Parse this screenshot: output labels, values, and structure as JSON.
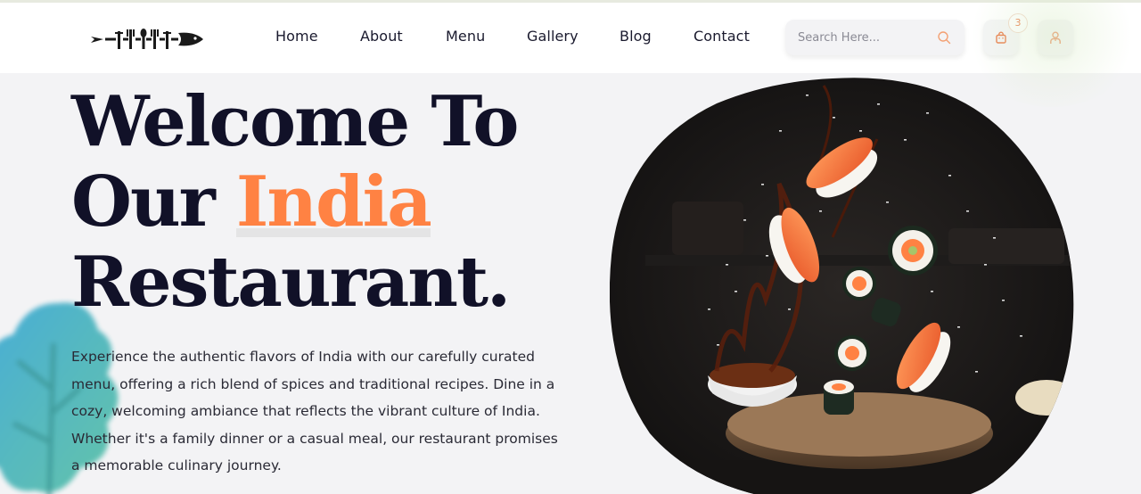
{
  "header": {
    "logo_name": "fork-spoon-fish-logo",
    "nav": [
      {
        "label": "Home"
      },
      {
        "label": "About"
      },
      {
        "label": "Menu"
      },
      {
        "label": "Gallery"
      },
      {
        "label": "Blog"
      },
      {
        "label": "Contact"
      }
    ],
    "search": {
      "placeholder": "Search Here...",
      "value": ""
    },
    "cart": {
      "icon": "shopping-bag-icon",
      "count": "3"
    },
    "user": {
      "icon": "user-icon"
    }
  },
  "hero": {
    "title_line1": "Welcome To",
    "title_line2_prefix": "Our ",
    "title_highlight": "India",
    "title_line3": "Restaurant.",
    "description": "Experience the authentic flavors of India with our carefully curated menu, offering a rich blend of spices and traditional recipes. Dine in a cozy, welcoming ambiance that reflects the vibrant culture of India. Whether it's a family dinner or a casual meal, our restaurant promises a memorable culinary journey.",
    "image": "flying-sushi-image"
  },
  "colors": {
    "accent": "#ff8243",
    "heading": "#111128",
    "background": "#f3f3f5",
    "header_bg": "#ffffff"
  }
}
